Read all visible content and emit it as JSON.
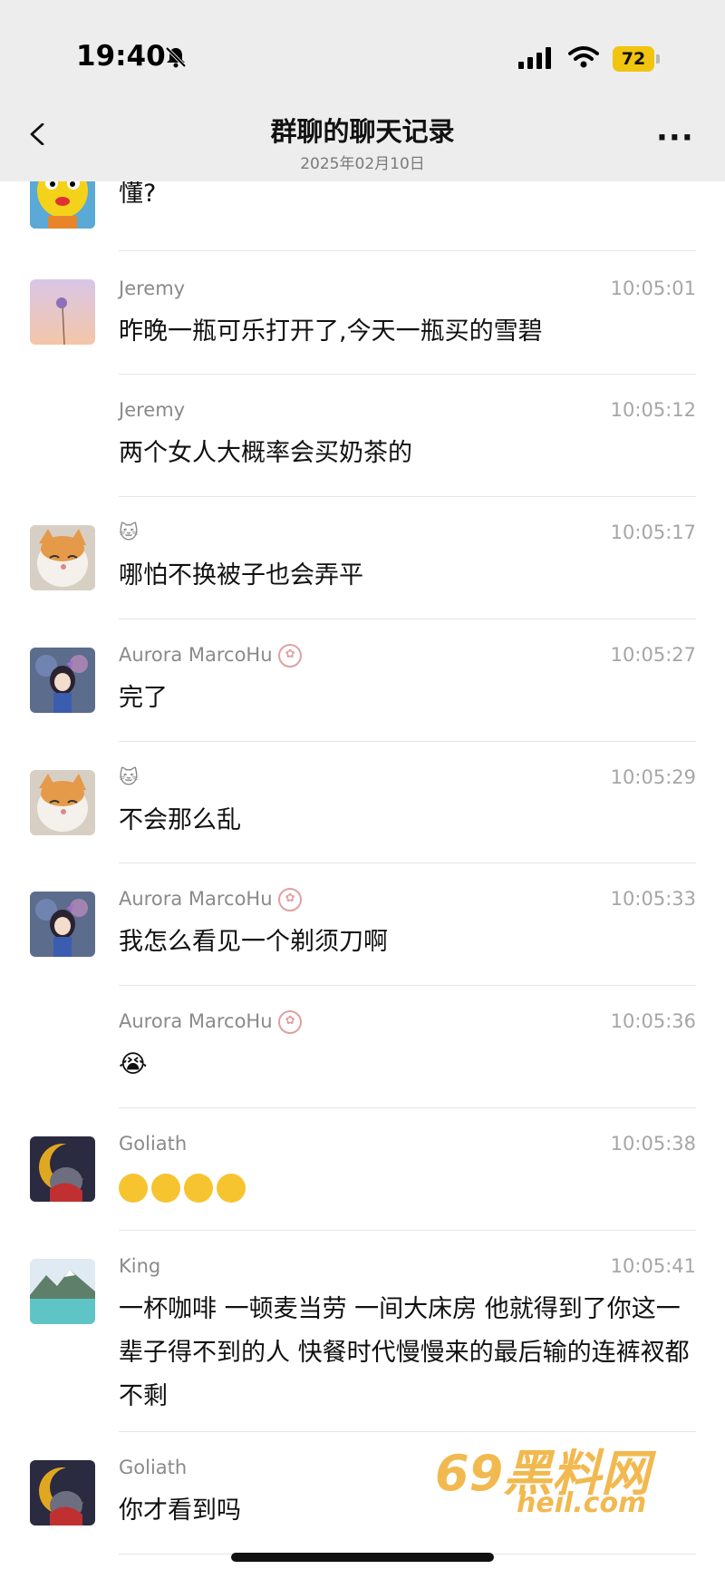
{
  "status_bar": {
    "time": "19:40",
    "battery": "72"
  },
  "header": {
    "title": "群聊的聊天记录",
    "date": "2025年02月10日"
  },
  "messages": [
    {
      "name": "",
      "time": "",
      "text": "懂?",
      "avatar": "yellow-cartoon-avatar"
    },
    {
      "name": "Jeremy",
      "time": "10:05:01",
      "text": "昨晚一瓶可乐打开了,今天一瓶买的雪碧",
      "avatar": "flower-avatar"
    },
    {
      "name": "Jeremy",
      "time": "10:05:12",
      "text": "两个女人大概率会买奶茶的",
      "avatar": ""
    },
    {
      "name": "🐱",
      "time": "10:05:17",
      "text": "哪怕不换被子也会弄平",
      "avatar": "cat-avatar"
    },
    {
      "name": "Aurora MarcoHu",
      "time": "10:05:27",
      "text": "完了",
      "avatar": "anime-girl-avatar"
    },
    {
      "name": "🐱",
      "time": "10:05:29",
      "text": "不会那么乱",
      "avatar": "cat-avatar"
    },
    {
      "name": "Aurora MarcoHu",
      "time": "10:05:33",
      "text": "我怎么看见一个剃须刀啊",
      "avatar": "anime-girl-avatar"
    },
    {
      "name": "Aurora MarcoHu",
      "time": "10:05:36",
      "text": "😭",
      "avatar": ""
    },
    {
      "name": "Goliath",
      "time": "10:05:38",
      "text": "",
      "avatar": "cartoon-cat-avatar",
      "emoji_count": 4
    },
    {
      "name": "King",
      "time": "10:05:41",
      "text": "一杯咖啡 一顿麦当劳 一间大床房 他就得到了你这一辈子得不到的人 快餐时代慢慢来的最后输的连裤衩都不剩",
      "avatar": "lake-avatar"
    },
    {
      "name": "Goliath",
      "time": "",
      "text": "你才看到吗",
      "avatar": "cartoon-cat-avatar"
    }
  ],
  "watermark": {
    "brand": "69黑料网",
    "domain": "heil.com"
  },
  "colors": {
    "header_bg": "#ededed",
    "battery": "#f1c40f",
    "name": "#8a8a8a",
    "time": "#a6a6a6"
  }
}
